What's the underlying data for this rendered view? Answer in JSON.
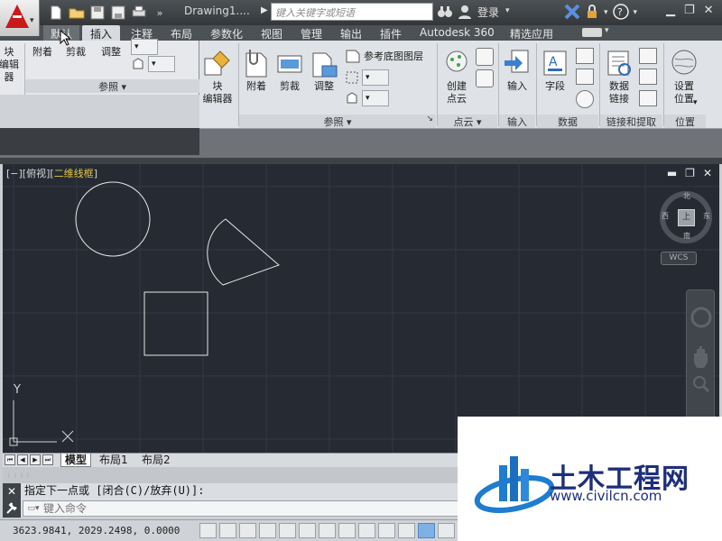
{
  "titlebar": {
    "doc_title": "Drawing1....",
    "search_placeholder": "键入关键字或短语",
    "login_label": "登录"
  },
  "tabs": [
    {
      "label": "默认"
    },
    {
      "label": "插入"
    },
    {
      "label": "注释"
    },
    {
      "label": "布局"
    },
    {
      "label": "参数化"
    },
    {
      "label": "视图"
    },
    {
      "label": "管理"
    },
    {
      "label": "输出"
    },
    {
      "label": "插件"
    },
    {
      "label": "Autodesk 360"
    },
    {
      "label": "精选应用"
    }
  ],
  "flyout": {
    "block_editor_partial": "块\n编辑器",
    "attach": "附着",
    "clip": "剪裁",
    "adjust": "调整",
    "panel_title": "参照"
  },
  "ribbon": {
    "block_editor": "块\n编辑器",
    "attach": "附着",
    "clip": "剪裁",
    "adjust": "调整",
    "underlay_layers": "参考底图图层",
    "panel_reference": "参照",
    "create_point_cloud": "创建\n点云",
    "panel_point_cloud": "点云",
    "import": "输入",
    "panel_import": "输入",
    "field": "字段",
    "panel_data": "数据",
    "data_link": "数据\n链接",
    "panel_link": "链接和提取",
    "set_location": "设置\n位置",
    "panel_location": "位置"
  },
  "viewport": {
    "bracket_a": "[−][俯视][",
    "style": "二维线框",
    "bracket_b": "]",
    "cube_face": "上",
    "north": "北",
    "south": "南",
    "west": "西",
    "east": "东",
    "wcs": "WCS",
    "ucs_y": "Y",
    "ucs_x": "X"
  },
  "layout_tabs": [
    {
      "label": "模型"
    },
    {
      "label": "布局1"
    },
    {
      "label": "布局2"
    }
  ],
  "command": {
    "history": "指定下一点或 [闭合(C)/放弃(U)]:",
    "placeholder": "键入命令"
  },
  "status": {
    "coords": "3623.9841, 2029.2498, 0.0000"
  },
  "watermark": {
    "brand": "土木工程网",
    "url": "www.civilcn.com"
  },
  "colors": {
    "canvas_bg": "#252a33",
    "viewport_style": "#e3c64a",
    "brand": "#1d2e7b",
    "app_logo": "#c8191b"
  }
}
